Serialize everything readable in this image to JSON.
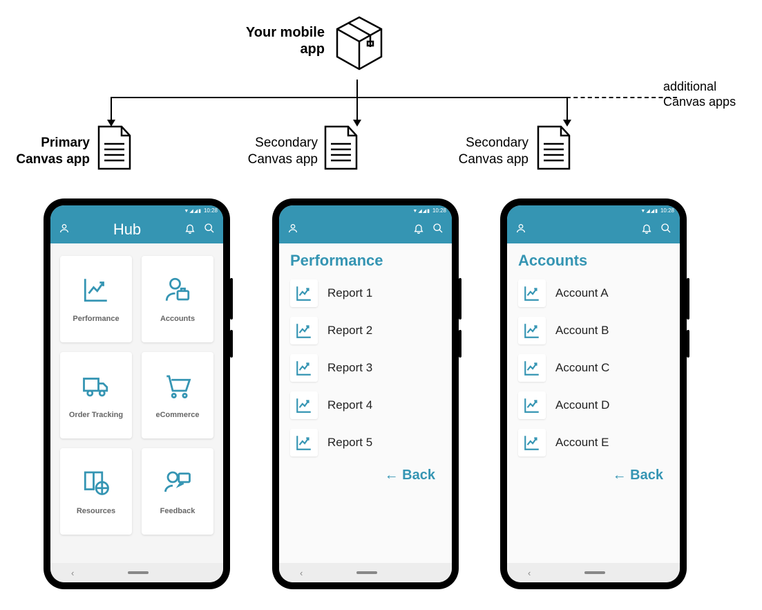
{
  "top": {
    "label": "Your mobile app",
    "additional": "additional Canvas apps"
  },
  "apps": {
    "primary": "Primary Canvas app",
    "secondary1": "Secondary Canvas app",
    "secondary2": "Secondary Canvas app"
  },
  "status": {
    "time": "10:28"
  },
  "hub": {
    "title": "Hub",
    "tiles": [
      {
        "label": "Performance"
      },
      {
        "label": "Accounts"
      },
      {
        "label": "Order Tracking"
      },
      {
        "label": "eCommerce"
      },
      {
        "label": "Resources"
      },
      {
        "label": "Feedback"
      }
    ]
  },
  "performance": {
    "title": "Performance",
    "items": [
      "Report 1",
      "Report 2",
      "Report 3",
      "Report 4",
      "Report 5"
    ],
    "back": "← Back"
  },
  "accounts": {
    "title": "Accounts",
    "items": [
      "Account A",
      "Account B",
      "Account C",
      "Account D",
      "Account E"
    ],
    "back": "← Back"
  }
}
